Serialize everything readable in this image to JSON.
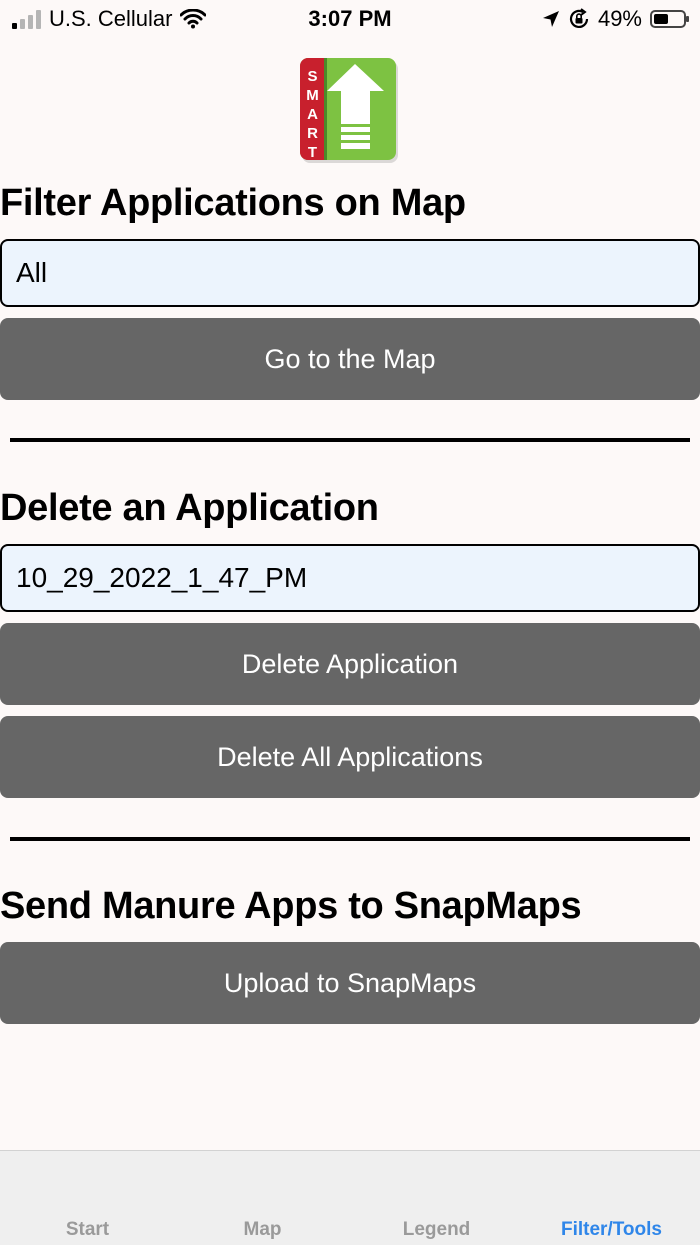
{
  "status_bar": {
    "carrier": "U.S. Cellular",
    "time": "3:07 PM",
    "battery": "49%"
  },
  "logo": {
    "letters": [
      "S",
      "M",
      "A",
      "R",
      "T"
    ]
  },
  "filter": {
    "title": "Filter Applications on Map",
    "selected": "All",
    "go_button": "Go to the Map"
  },
  "delete": {
    "title": "Delete an Application",
    "selected": "10_29_2022_1_47_PM",
    "delete_button": "Delete Application",
    "delete_all_button": "Delete All Applications"
  },
  "send": {
    "title": "Send Manure Apps to SnapMaps",
    "upload_button": "Upload to SnapMaps"
  },
  "tabs": [
    {
      "label": "Start"
    },
    {
      "label": "Map"
    },
    {
      "label": "Legend"
    },
    {
      "label": "Filter/Tools"
    }
  ],
  "colors": {
    "button": "#666666",
    "field_bg": "#ecf4fd",
    "active_tab": "#2f86e9",
    "logo_red": "#c8202d",
    "logo_green": "#7dc242"
  }
}
